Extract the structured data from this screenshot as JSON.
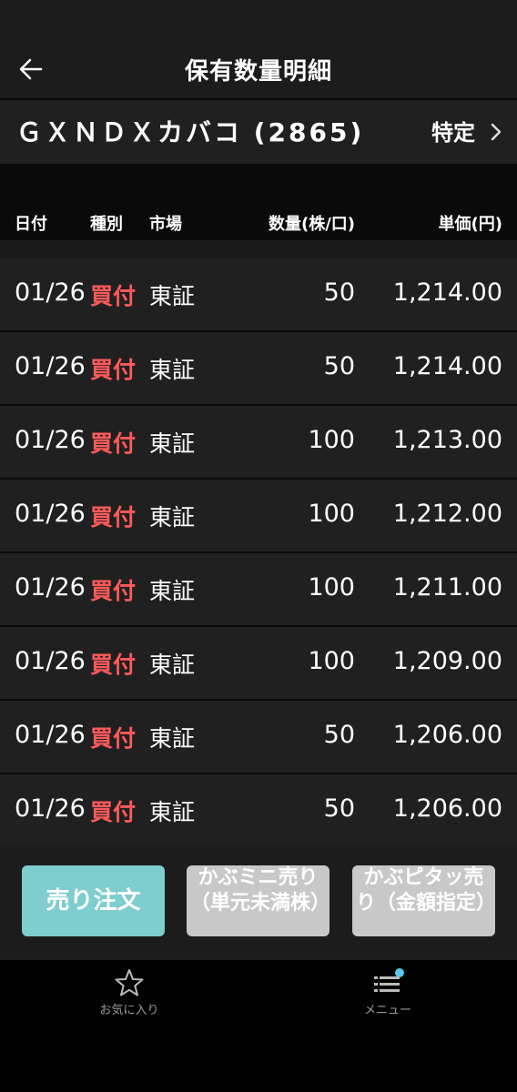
{
  "header": {
    "title": "保有数量明細"
  },
  "stock": {
    "name": "ＧＸＮＤＸカバコ (2865)",
    "account_type": "特定"
  },
  "columns": {
    "date": "日付",
    "kind": "種別",
    "market": "市場",
    "quantity": "数量(株/口)",
    "price": "単価(円)"
  },
  "rows": [
    {
      "date": "01/26",
      "kind": "買付",
      "market": "東証",
      "quantity": "50",
      "price": "1,214.00"
    },
    {
      "date": "01/26",
      "kind": "買付",
      "market": "東証",
      "quantity": "50",
      "price": "1,214.00"
    },
    {
      "date": "01/26",
      "kind": "買付",
      "market": "東証",
      "quantity": "100",
      "price": "1,213.00"
    },
    {
      "date": "01/26",
      "kind": "買付",
      "market": "東証",
      "quantity": "100",
      "price": "1,212.00"
    },
    {
      "date": "01/26",
      "kind": "買付",
      "market": "東証",
      "quantity": "100",
      "price": "1,211.00"
    },
    {
      "date": "01/26",
      "kind": "買付",
      "market": "東証",
      "quantity": "100",
      "price": "1,209.00"
    },
    {
      "date": "01/26",
      "kind": "買付",
      "market": "東証",
      "quantity": "50",
      "price": "1,206.00"
    },
    {
      "date": "01/26",
      "kind": "買付",
      "market": "東証",
      "quantity": "50",
      "price": "1,206.00"
    }
  ],
  "actions": {
    "sell_order": "売り注文",
    "kabu_mini_sell": "かぶミニ売り（単元未満株）",
    "kabu_pita_sell": "かぶピタッ売り（金額指定）"
  },
  "tabs": {
    "favorites": "お気に入り",
    "menu": "メニュー"
  },
  "colors": {
    "kind_buy": "#ff5a5a",
    "sell_button": "#7ecdcf",
    "disabled_button": "#c8c8c8",
    "badge": "#5bc8e8"
  }
}
